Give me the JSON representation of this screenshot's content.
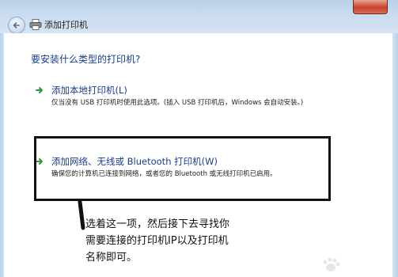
{
  "window": {
    "title": "添加打印机"
  },
  "heading": "要安装什么类型的打印机?",
  "options": [
    {
      "title": "添加本地打印机(L)",
      "description": "仅当没有 USB 打印机时使用此选项。(插入 USB 打印机后，Windows 会自动安装。)",
      "icon": "green-arrow-icon"
    },
    {
      "title": "添加网络、无线或 Bluetooth 打印机(W)",
      "description": "确保您的计算机已连接到网络，或者您的 Bluetooth 或无线打印机已启用。",
      "icon": "green-arrow-icon"
    }
  ],
  "annotation": {
    "line1": "选着这一项，然后接下去寻找你",
    "line2": "需要连接的打印机IP以及打印机",
    "line3": "名称即可。"
  },
  "colors": {
    "link": "#1a3c8c",
    "arrow": "#2e9a2e",
    "frame": "#b9d1ea",
    "close": "#c7432b",
    "annotation_border": "#111111"
  }
}
